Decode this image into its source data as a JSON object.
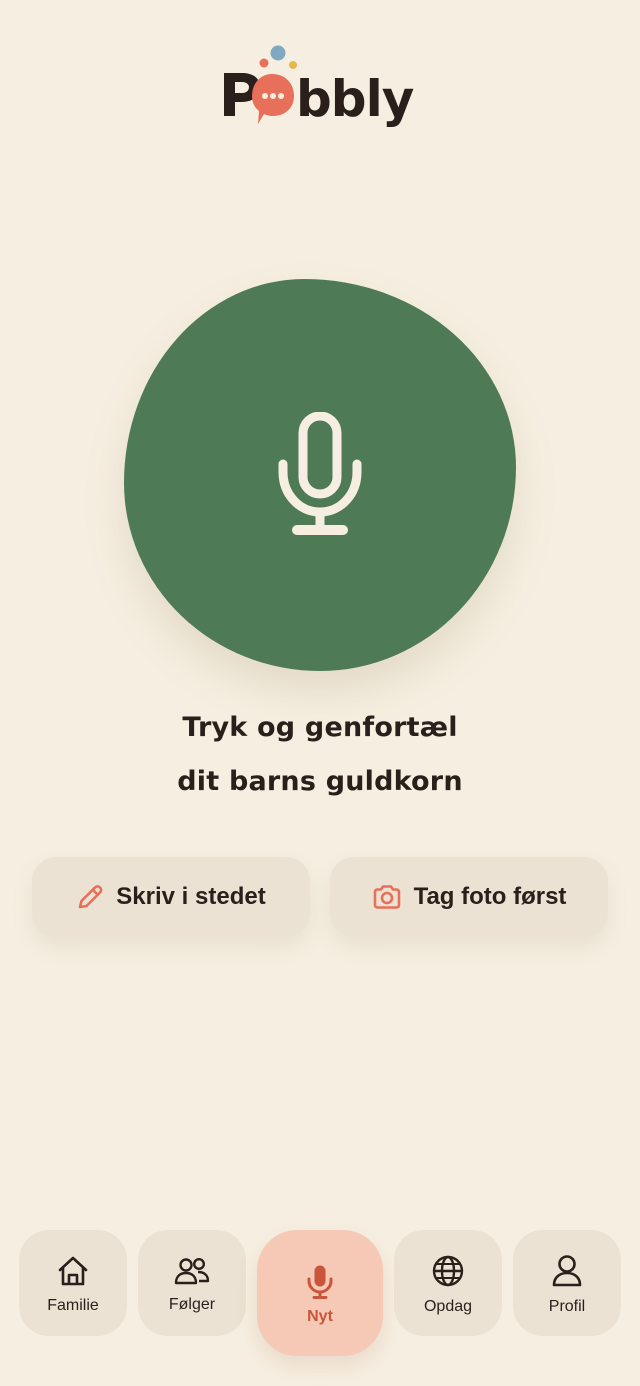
{
  "app": {
    "logo_text": "Pobbly",
    "colors": {
      "background": "#f6efe1",
      "primary_green": "#4e7b56",
      "accent_coral": "#e8705a",
      "surface": "#ebe2d4",
      "active_nav": "#f5c9b5",
      "text": "#2a1f1b"
    }
  },
  "record": {
    "icon": "microphone-icon",
    "prompt_line1": "Tryk og genfortæl",
    "prompt_line2": "dit barns guldkorn"
  },
  "actions": {
    "write": {
      "label": "Skriv i stedet",
      "icon": "pencil-icon"
    },
    "photo": {
      "label": "Tag foto først",
      "icon": "camera-icon"
    }
  },
  "nav": {
    "items": [
      {
        "label": "Familie",
        "icon": "home-icon"
      },
      {
        "label": "Følger",
        "icon": "people-icon"
      },
      {
        "label": "Nyt",
        "icon": "microphone-icon",
        "active": true
      },
      {
        "label": "Opdag",
        "icon": "globe-icon"
      },
      {
        "label": "Profil",
        "icon": "user-icon"
      }
    ]
  }
}
